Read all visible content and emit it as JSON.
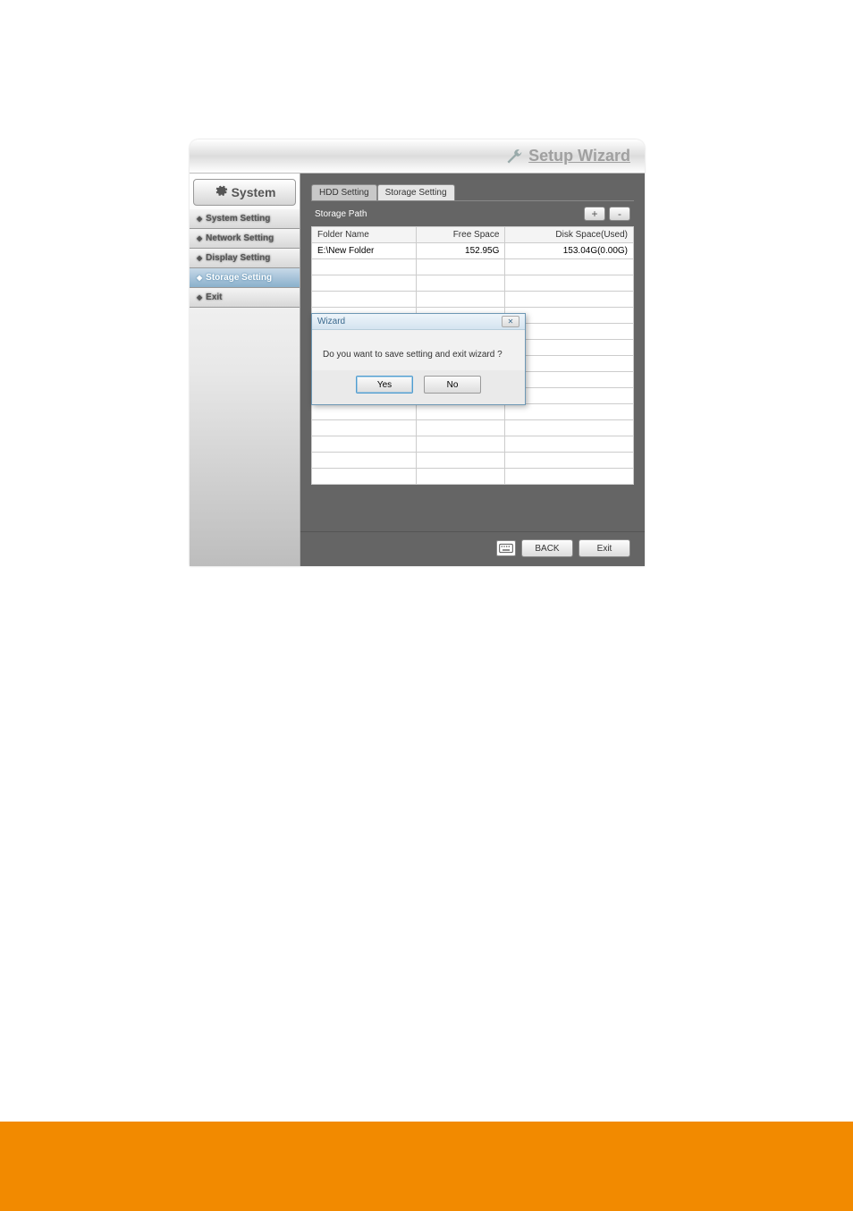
{
  "app": {
    "title": "Setup Wizard"
  },
  "sidebar": {
    "header": "System",
    "items": [
      {
        "label": "System Setting"
      },
      {
        "label": "Network Setting"
      },
      {
        "label": "Display Setting"
      },
      {
        "label": "Storage Setting"
      },
      {
        "label": "Exit"
      }
    ],
    "active_index": 3
  },
  "tabs": [
    {
      "label": "HDD Setting"
    },
    {
      "label": "Storage Setting"
    }
  ],
  "active_tab": 1,
  "storage": {
    "path_label": "Storage Path",
    "add_btn": "+",
    "remove_btn": "-",
    "columns": [
      "Folder Name",
      "Free Space",
      "Disk Space(Used)"
    ],
    "rows": [
      {
        "folder": "E:\\New Folder",
        "free": "152.95G",
        "disk": "153.04G(0.00G)"
      }
    ]
  },
  "footer": {
    "back": "BACK",
    "exit": "Exit"
  },
  "modal": {
    "title": "Wizard",
    "message": "Do you want to save setting and exit wizard ?",
    "yes": "Yes",
    "no": "No"
  }
}
